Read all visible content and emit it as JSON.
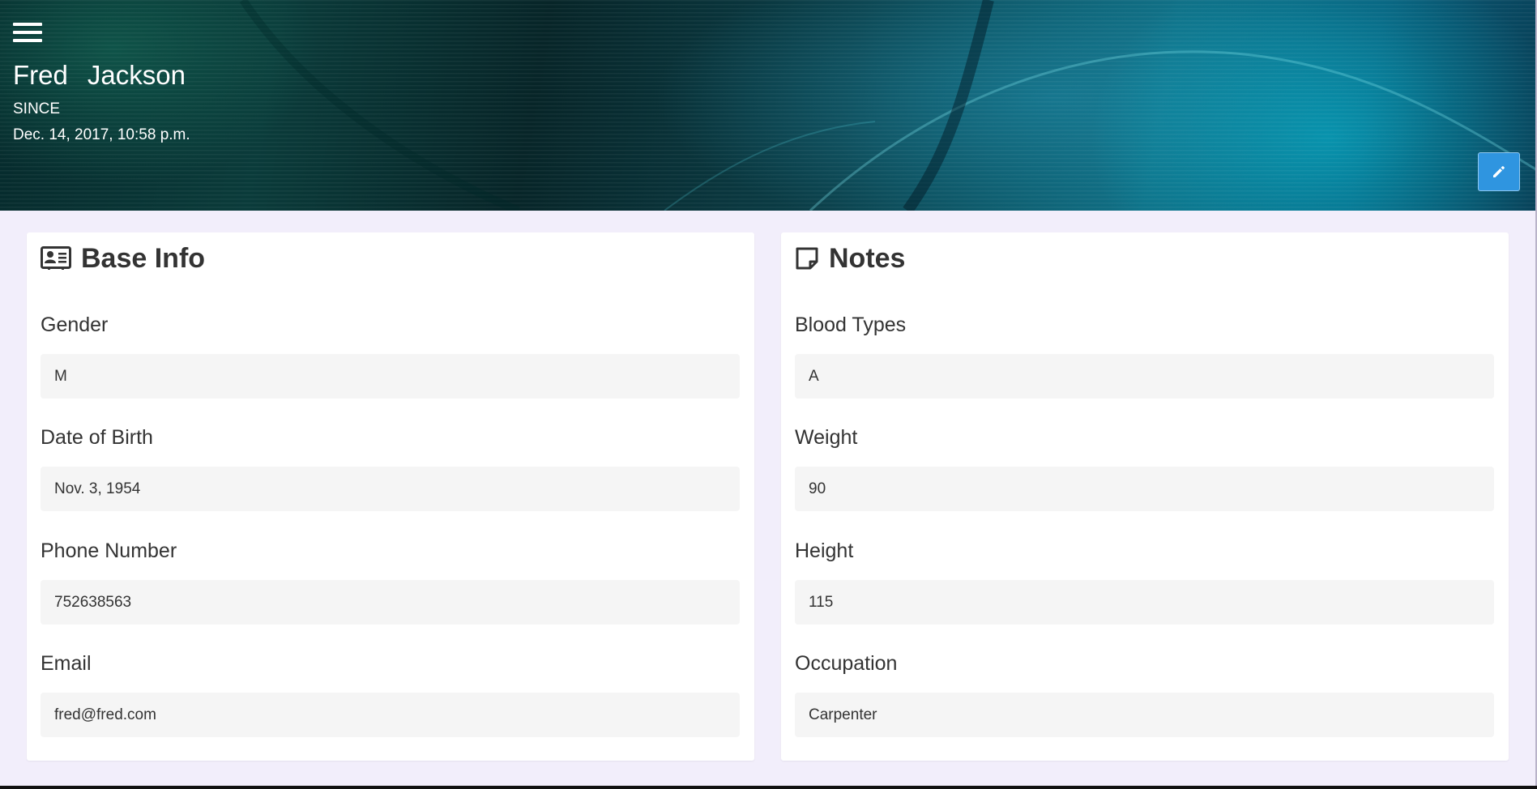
{
  "header": {
    "first_name": "Fred",
    "last_name": "Jackson",
    "since_label": "SINCE",
    "since_date": "Dec. 14, 2017, 10:58 p.m."
  },
  "icons": {
    "menu": "hamburger-menu-icon",
    "edit": "pencil-icon",
    "base_info": "id-card-icon",
    "notes": "sticky-note-icon"
  },
  "colors": {
    "edit_button": "#2f95e0",
    "page_background": "#f2eefb",
    "field_background": "#f5f5f5"
  },
  "base_info": {
    "title": "Base Info",
    "fields": [
      {
        "label": "Gender",
        "value": "M"
      },
      {
        "label": "Date of Birth",
        "value": "Nov. 3, 1954"
      },
      {
        "label": "Phone Number",
        "value": "752638563"
      },
      {
        "label": "Email",
        "value": "fred@fred.com"
      }
    ]
  },
  "notes": {
    "title": "Notes",
    "fields": [
      {
        "label": "Blood Types",
        "value": "A"
      },
      {
        "label": "Weight",
        "value": "90"
      },
      {
        "label": "Height",
        "value": "115"
      },
      {
        "label": "Occupation",
        "value": "Carpenter"
      }
    ]
  }
}
